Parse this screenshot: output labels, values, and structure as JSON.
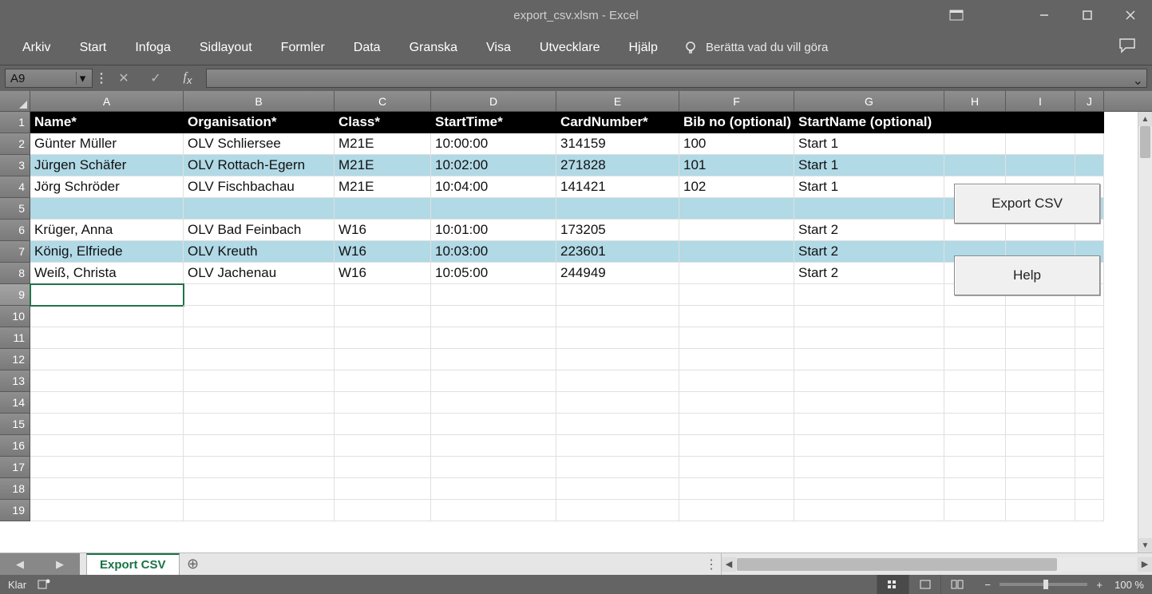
{
  "title": "export_csv.xlsm  -  Excel",
  "ribbon_tabs": [
    "Arkiv",
    "Start",
    "Infoga",
    "Sidlayout",
    "Formler",
    "Data",
    "Granska",
    "Visa",
    "Utvecklare",
    "Hjälp"
  ],
  "tell_me": "Berätta vad du vill göra",
  "namebox": "A9",
  "formula": "",
  "columns": [
    "A",
    "B",
    "C",
    "D",
    "E",
    "F",
    "G",
    "H",
    "I",
    "J"
  ],
  "row_numbers": [
    "1",
    "2",
    "3",
    "4",
    "5",
    "6",
    "7",
    "8",
    "9",
    "10",
    "11",
    "12",
    "13",
    "14",
    "15",
    "16",
    "17",
    "18",
    "19"
  ],
  "headers": [
    "Name*",
    "Organisation*",
    "Class*",
    "StartTime*",
    "CardNumber*",
    "Bib no (optional)",
    "StartName (optional)"
  ],
  "rows": [
    {
      "name": "Günter Müller",
      "org": "OLV Schliersee",
      "cls": "M21E",
      "start": "10:00:00",
      "card": "314159",
      "bib": "100",
      "startname": "Start 1"
    },
    {
      "name": "Jürgen Schäfer",
      "org": "OLV Rottach-Egern",
      "cls": "M21E",
      "start": "10:02:00",
      "card": "271828",
      "bib": "101",
      "startname": "Start 1"
    },
    {
      "name": "Jörg Schröder",
      "org": "OLV Fischbachau",
      "cls": "M21E",
      "start": "10:04:00",
      "card": "141421",
      "bib": "102",
      "startname": "Start 1"
    },
    {
      "name": "",
      "org": "",
      "cls": "",
      "start": "",
      "card": "",
      "bib": "",
      "startname": ""
    },
    {
      "name": "Krüger, Anna",
      "org": "OLV Bad Feinbach",
      "cls": "W16",
      "start": "10:01:00",
      "card": "173205",
      "bib": "",
      "startname": "Start 2"
    },
    {
      "name": "König, Elfriede",
      "org": "OLV Kreuth",
      "cls": "W16",
      "start": "10:03:00",
      "card": "223601",
      "bib": "",
      "startname": "Start 2"
    },
    {
      "name": "Weiß, Christa",
      "org": "OLV Jachenau",
      "cls": "W16",
      "start": "10:05:00",
      "card": "244949",
      "bib": "",
      "startname": "Start 2"
    }
  ],
  "buttons": {
    "export": "Export CSV",
    "help": "Help"
  },
  "sheet_tab": "Export CSV",
  "status": "Klar",
  "zoom": "100 %"
}
